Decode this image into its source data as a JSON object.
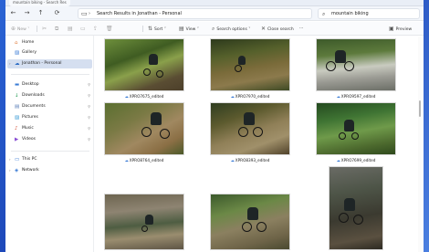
{
  "window": {
    "tab_title": "mountain biking - Search Res",
    "address": "Search Results in Jonathan - Personal",
    "search_value": "mountain biking"
  },
  "toolbar": {
    "new_label": "New",
    "sort_label": "Sort",
    "view_label": "View",
    "search_options_label": "Search options",
    "close_search_label": "Close search",
    "more_label": "···",
    "preview_label": "Preview"
  },
  "sidebar": {
    "items": [
      {
        "label": "Home",
        "icon": "home-icon"
      },
      {
        "label": "Gallery",
        "icon": "gallery-icon"
      },
      {
        "label": "Jonathan - Personal",
        "icon": "cloud-icon"
      },
      {
        "label": "Desktop",
        "icon": "desktop-icon"
      },
      {
        "label": "Downloads",
        "icon": "downloads-icon"
      },
      {
        "label": "Documents",
        "icon": "documents-icon"
      },
      {
        "label": "Pictures",
        "icon": "pictures-icon"
      },
      {
        "label": "Music",
        "icon": "music-icon"
      },
      {
        "label": "Videos",
        "icon": "videos-icon"
      },
      {
        "label": "This PC",
        "icon": "pc-icon"
      },
      {
        "label": "Network",
        "icon": "network-icon"
      }
    ]
  },
  "files": [
    {
      "name": "XPRO7675_edited"
    },
    {
      "name": "XPRO7970_edited"
    },
    {
      "name": "XPRO9597_edited"
    },
    {
      "name": "XPRO8764_edited"
    },
    {
      "name": "XPRO8393_edited"
    },
    {
      "name": "XPRO7699_edited"
    },
    {
      "name": ""
    },
    {
      "name": ""
    },
    {
      "name": ""
    }
  ],
  "colors": {
    "accent": "#3a7bd5",
    "selection": "#d5dff0"
  }
}
